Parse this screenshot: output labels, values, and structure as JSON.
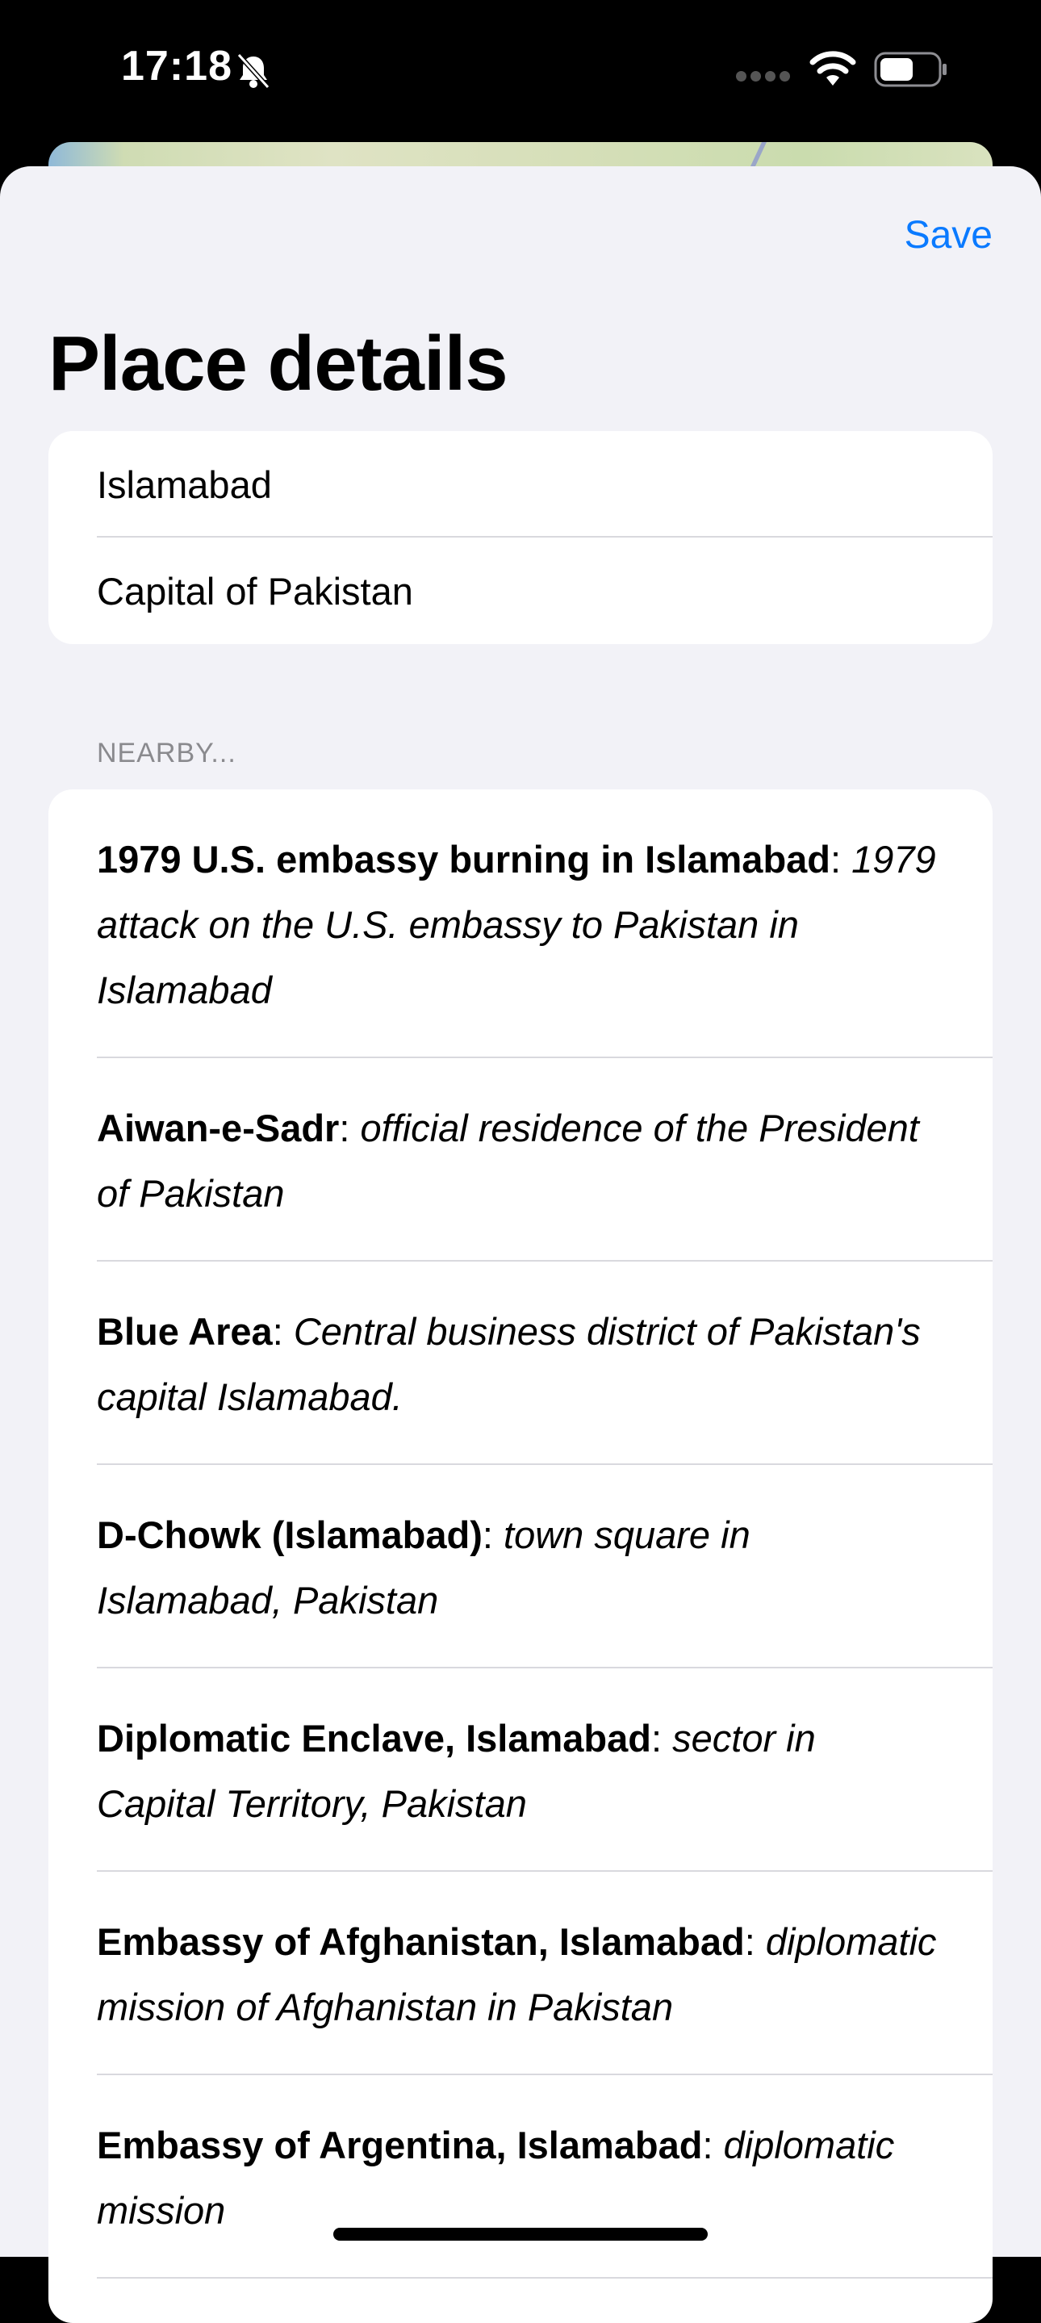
{
  "status_bar": {
    "time": "17:18",
    "icons": [
      "bell-slash-icon",
      "cellular-signal-icon",
      "wifi-icon",
      "battery-icon"
    ]
  },
  "toolbar": {
    "save_label": "Save"
  },
  "page": {
    "title": "Place details"
  },
  "fields": {
    "name_value": "Islamabad",
    "description_value": "Capital of Pakistan"
  },
  "nearby": {
    "header": "NEARBY...",
    "items": [
      {
        "name": "1979 U.S. embassy burning in Islamabad",
        "sep": ": ",
        "desc": "1979 attack on the U.S. embassy to Pakistan in Islamabad"
      },
      {
        "name": "Aiwan-e-Sadr",
        "sep": ": ",
        "desc": "official residence of the President of Pakistan"
      },
      {
        "name": "Blue Area",
        "sep": ": ",
        "desc": "Central business district of Pakistan's capital Islamabad."
      },
      {
        "name": "D-Chowk (Islamabad)",
        "sep": ": ",
        "desc": "town square in Islamabad, Pakistan"
      },
      {
        "name": "Diplomatic Enclave, Islamabad",
        "sep": ": ",
        "desc": "sector in Capital Territory, Pakistan"
      },
      {
        "name": "Embassy of Afghanistan, Islamabad",
        "sep": ": ",
        "desc": "diplomatic mission of Afghanistan in Pakistan"
      },
      {
        "name": "Embassy of Argentina, Islamabad",
        "sep": ": ",
        "desc": "diplomatic mission"
      }
    ]
  },
  "colors": {
    "accent": "#0a7aff",
    "sheet_background": "#f2f2f7",
    "secondary_text": "#8a8a8e"
  }
}
